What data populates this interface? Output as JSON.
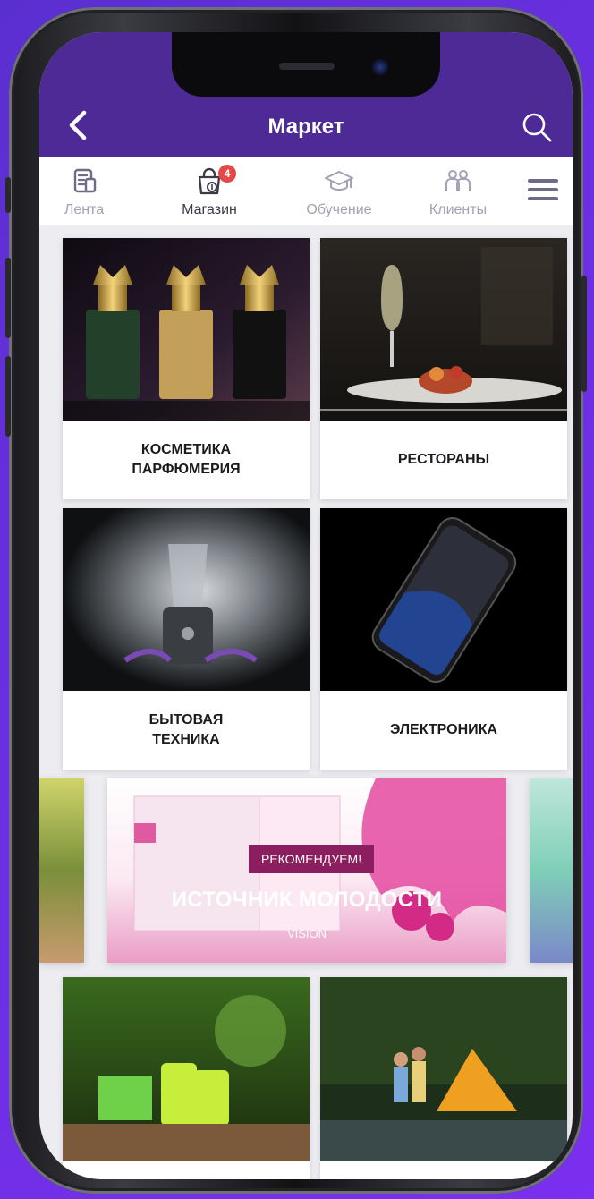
{
  "header": {
    "title": "Маркет"
  },
  "tabs": [
    {
      "label": "Лента",
      "icon": "news-feed-icon"
    },
    {
      "label": "Магазин",
      "icon": "shopping-bag-icon",
      "badge": "4",
      "active": true
    },
    {
      "label": "Обучение",
      "icon": "graduation-cap-icon"
    },
    {
      "label": "Клиенты",
      "icon": "clients-icon"
    }
  ],
  "categories": [
    {
      "label": "КОСМЕТИКА\nПАРФЮМЕРИЯ"
    },
    {
      "label": "РЕСТОРАНЫ"
    },
    {
      "label": "БЫТОВАЯ\nТЕХНИКА"
    },
    {
      "label": "ЭЛЕКТРОНИКА"
    }
  ],
  "banner": {
    "tag": "РЕКОМЕНДУЕМ!",
    "title": "ИСТОЧНИК МОЛОДОСТИ",
    "subtitle": "VISION"
  },
  "colors": {
    "header": "#4e2a97",
    "badge": "#e54848",
    "tag": "#8a1e5e"
  }
}
